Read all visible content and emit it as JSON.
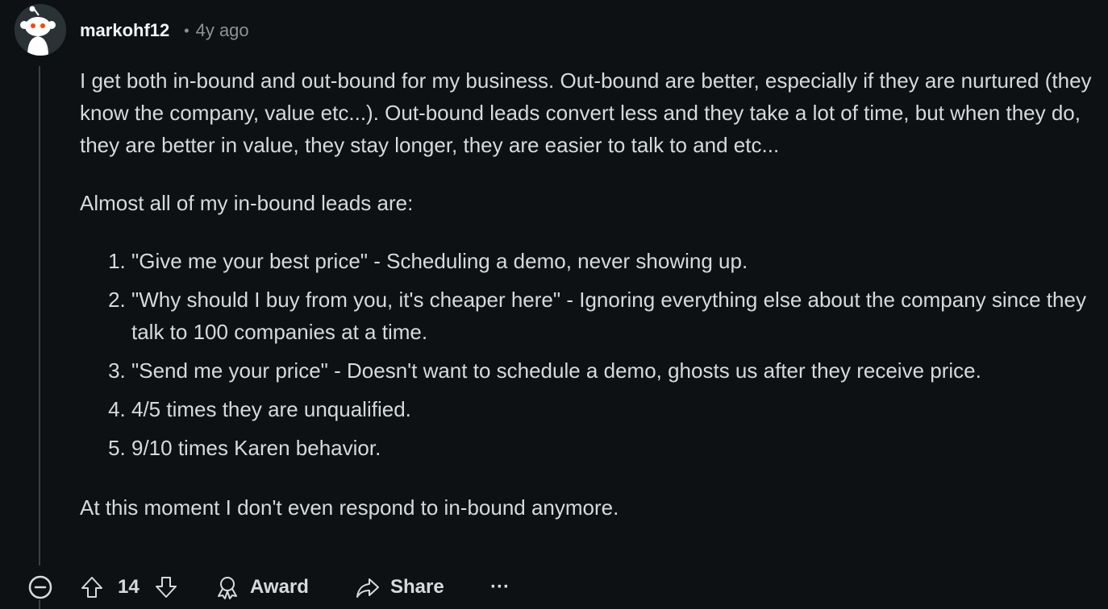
{
  "comment": {
    "username": "markohf12",
    "separator": "•",
    "time": "4y ago",
    "paragraph1": "I get both in-bound and out-bound for my business. Out-bound are better, especially if they are nurtured (they know the company, value etc...). Out-bound leads convert less and they take a lot of time, but when they do, they are better in value, they stay longer, they are easier to talk to and etc...",
    "paragraph2": "Almost all of my in-bound leads are:",
    "list": [
      "\"Give me your best price\" - Scheduling a demo, never showing up.",
      "\"Why should I buy from you, it's cheaper here\" - Ignoring everything else about the company since they talk to 100 companies at a time.",
      "\"Send me your price\" - Doesn't want to schedule a demo, ghosts us after they receive price.",
      "4/5 times they are unqualified.",
      "9/10 times Karen behavior."
    ],
    "paragraph3": "At this moment I don't even respond to in-bound anymore."
  },
  "actions": {
    "vote_count": "14",
    "award_label": "Award",
    "share_label": "Share",
    "more_label": "···"
  },
  "icons": {
    "avatar": "reddit-snoo-avatar-icon",
    "collapse": "collapse-minus-icon",
    "upvote": "upvote-arrow-icon",
    "downvote": "downvote-arrow-icon",
    "award": "award-ribbon-icon",
    "share": "share-arrow-icon",
    "more": "more-dots-icon"
  },
  "colors": {
    "background": "#0e1113",
    "text": "#d7dadc",
    "muted": "#8c9296",
    "thread_line": "#3a4145",
    "avatar_accent": "#ff4500"
  }
}
